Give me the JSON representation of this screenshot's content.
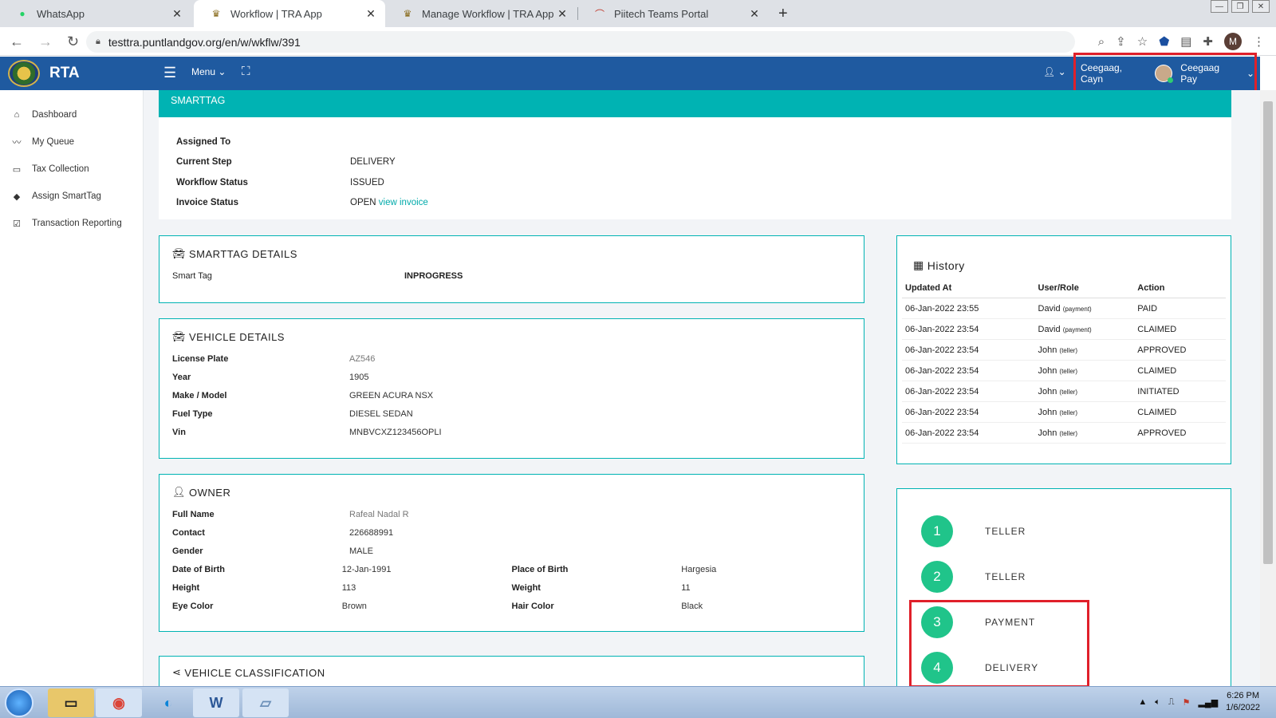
{
  "browser": {
    "tabs": [
      {
        "title": "WhatsApp",
        "icon": "whatsapp-icon"
      },
      {
        "title": "Workflow | TRA App",
        "icon": "rta-crest-icon"
      },
      {
        "title": "Manage Workflow | TRA App",
        "icon": "rta-crest-icon"
      },
      {
        "title": "Piitech Teams Portal",
        "icon": "teams-portal-icon"
      }
    ],
    "url": "testtra.puntlandgov.org/en/w/wkflw/391",
    "profile_initial": "M"
  },
  "app": {
    "brand": "RTA",
    "menu_label": "Menu",
    "user_name": "Ceegaag, Cayn",
    "user_role": "Ceegaag Pay"
  },
  "sidebar": {
    "items": [
      {
        "label": "Dashboard",
        "icon": "home-icon"
      },
      {
        "label": "My Queue",
        "icon": "trend-icon"
      },
      {
        "label": "Tax Collection",
        "icon": "card-icon"
      },
      {
        "label": "Assign SmartTag",
        "icon": "tags-icon"
      },
      {
        "label": "Transaction Reporting",
        "icon": "check-icon"
      }
    ]
  },
  "header": {
    "title": "SMARTTAG"
  },
  "summary": {
    "assigned_to_label": "Assigned To",
    "assigned_to": "",
    "current_step_label": "Current Step",
    "current_step": "DELIVERY",
    "workflow_status_label": "Workflow Status",
    "workflow_status": "ISSUED",
    "invoice_status_label": "Invoice Status",
    "invoice_status": "OPEN",
    "view_invoice": "view invoice"
  },
  "smarttag_details": {
    "title": "SMARTTAG DETAILS",
    "smart_tag_label": "Smart Tag",
    "smart_tag": "INPROGRESS"
  },
  "vehicle_details": {
    "title": "VEHICLE DETAILS",
    "rows": [
      {
        "label": "License Plate",
        "value": "AZ546"
      },
      {
        "label": "Year",
        "value": "1905"
      },
      {
        "label": "Make / Model",
        "value": "GREEN ACURA NSX"
      },
      {
        "label": "Fuel Type",
        "value": "DIESEL SEDAN"
      },
      {
        "label": "Vin",
        "value": "MNBVCXZ123456OPLI"
      }
    ]
  },
  "owner": {
    "title": "OWNER",
    "full_name_label": "Full Name",
    "full_name": "Rafeal Nadal R",
    "contact_label": "Contact",
    "contact": "226688991",
    "gender_label": "Gender",
    "gender": "MALE",
    "dob_label": "Date of Birth",
    "dob": "12-Jan-1991",
    "pob_label": "Place of Birth",
    "pob": "Hargesia",
    "height_label": "Height",
    "height": "113",
    "weight_label": "Weight",
    "weight": "11",
    "eye_label": "Eye Color",
    "eye": "Brown",
    "hair_label": "Hair Color",
    "hair": "Black"
  },
  "classification": {
    "title": "VEHICLE CLASSIFICATION"
  },
  "history": {
    "title": "History",
    "headers": [
      "Updated At",
      "User/Role",
      "Action"
    ],
    "rows": [
      {
        "at": "06-Jan-2022 23:55",
        "user": "David",
        "role": "(payment)",
        "action": "PAID"
      },
      {
        "at": "06-Jan-2022 23:54",
        "user": "David",
        "role": "(payment)",
        "action": "CLAIMED"
      },
      {
        "at": "06-Jan-2022 23:54",
        "user": "John",
        "role": "(teller)",
        "action": "APPROVED"
      },
      {
        "at": "06-Jan-2022 23:54",
        "user": "John",
        "role": "(teller)",
        "action": "CLAIMED"
      },
      {
        "at": "06-Jan-2022 23:54",
        "user": "John",
        "role": "(teller)",
        "action": "INITIATED"
      },
      {
        "at": "06-Jan-2022 23:54",
        "user": "John",
        "role": "(teller)",
        "action": "CLAIMED"
      },
      {
        "at": "06-Jan-2022 23:54",
        "user": "John",
        "role": "(teller)",
        "action": "APPROVED"
      }
    ]
  },
  "steps": [
    {
      "num": "1",
      "label": "TELLER"
    },
    {
      "num": "2",
      "label": "TELLER"
    },
    {
      "num": "3",
      "label": "PAYMENT"
    },
    {
      "num": "4",
      "label": "DELIVERY"
    }
  ],
  "taskbar": {
    "time": "6:26 PM",
    "date": "1/6/2022"
  },
  "colors": {
    "nav": "#1f5aa0",
    "teal": "#00b3b3",
    "step": "#20c48a",
    "highlight": "#e0202a"
  }
}
